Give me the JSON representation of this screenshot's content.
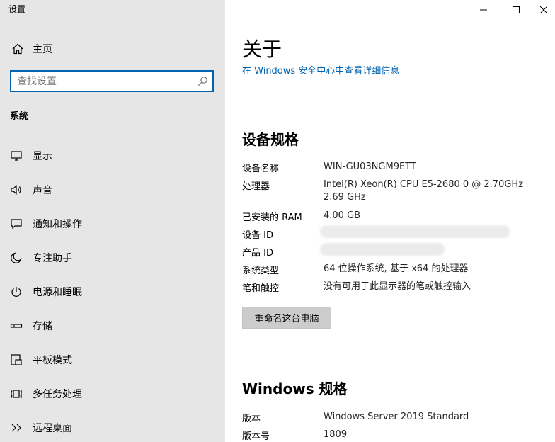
{
  "window": {
    "title": "设置"
  },
  "sidebar": {
    "home_label": "主页",
    "search_placeholder": "查找设置",
    "section_label": "系统",
    "items": [
      {
        "label": "显示",
        "icon": "monitor-icon"
      },
      {
        "label": "声音",
        "icon": "speaker-icon"
      },
      {
        "label": "通知和操作",
        "icon": "notification-icon"
      },
      {
        "label": "专注助手",
        "icon": "moon-icon"
      },
      {
        "label": "电源和睡眠",
        "icon": "power-icon"
      },
      {
        "label": "存储",
        "icon": "storage-icon"
      },
      {
        "label": "平板模式",
        "icon": "tablet-icon"
      },
      {
        "label": "多任务处理",
        "icon": "multitask-icon"
      },
      {
        "label": "远程桌面",
        "icon": "remote-desktop-icon"
      }
    ]
  },
  "main": {
    "title": "关于",
    "security_link": "在 Windows 安全中心中查看详细信息",
    "device_spec_title": "设备规格",
    "device_specs": {
      "device_name": {
        "label": "设备名称",
        "value": "WIN-GU03NGM9ETT"
      },
      "processor": {
        "label": "处理器",
        "value": "Intel(R) Xeon(R) CPU E5-2680 0 @ 2.70GHz   2.69 GHz"
      },
      "ram": {
        "label": "已安装的 RAM",
        "value": "4.00 GB"
      },
      "device_id": {
        "label": "设备 ID",
        "value": ""
      },
      "product_id": {
        "label": "产品 ID",
        "value": ""
      },
      "system_type": {
        "label": "系统类型",
        "value": "64 位操作系统, 基于 x64 的处理器"
      },
      "pen_touch": {
        "label": "笔和触控",
        "value": "没有可用于此显示器的笔或触控输入"
      }
    },
    "rename_button": "重命名这台电脑",
    "windows_spec_title": "Windows 规格",
    "windows_specs": {
      "edition": {
        "label": "版本",
        "value": "Windows Server 2019 Standard"
      },
      "version": {
        "label": "版本号",
        "value": "1809"
      }
    }
  },
  "colors": {
    "sidebar_bg": "#e6e6e6",
    "accent": "#0063b1",
    "button_bg": "#cccccc"
  }
}
